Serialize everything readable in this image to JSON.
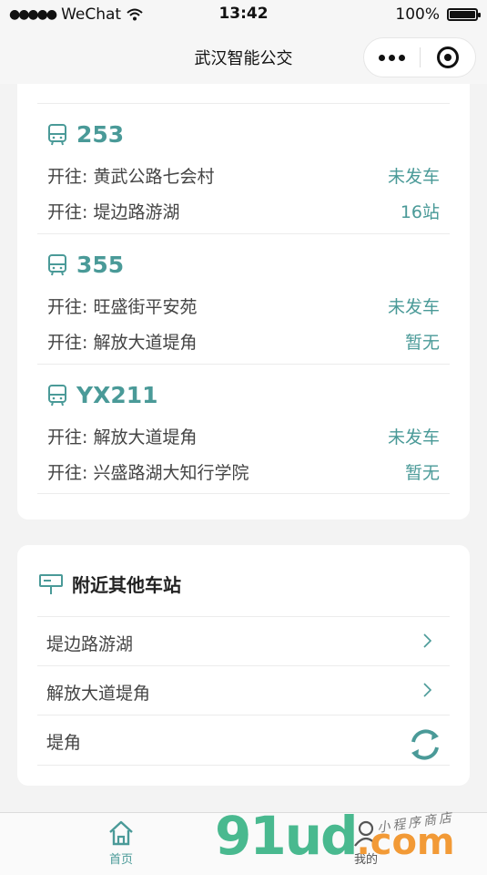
{
  "status_bar": {
    "carrier": "WeChat",
    "time": "13:42",
    "battery": "100%"
  },
  "nav": {
    "title": "武汉智能公交"
  },
  "routes": [
    {
      "number": "253",
      "rows": [
        {
          "direction": "开往: 黄武公路七会村",
          "status": "未发车"
        },
        {
          "direction": "开往: 堤边路游湖",
          "status": "16站"
        }
      ]
    },
    {
      "number": "355",
      "rows": [
        {
          "direction": "开往: 旺盛街平安苑",
          "status": "未发车"
        },
        {
          "direction": "开往: 解放大道堤角",
          "status": "暂无"
        }
      ]
    },
    {
      "number": "YX211",
      "rows": [
        {
          "direction": "开往: 解放大道堤角",
          "status": "未发车"
        },
        {
          "direction": "开往: 兴盛路湖大知行学院",
          "status": "暂无"
        }
      ]
    }
  ],
  "nearby": {
    "title": "附近其他车站",
    "stops": [
      "堤边路游湖",
      "解放大道堤角",
      "堤角"
    ]
  },
  "tab_bar": {
    "home": "首页",
    "mine": "我的"
  },
  "watermark": {
    "brand": "91ud",
    "domain": ".com",
    "subtitle": "小程序商店"
  },
  "colors": {
    "accent": "#4a9a98",
    "background": "#f3f3f3"
  }
}
